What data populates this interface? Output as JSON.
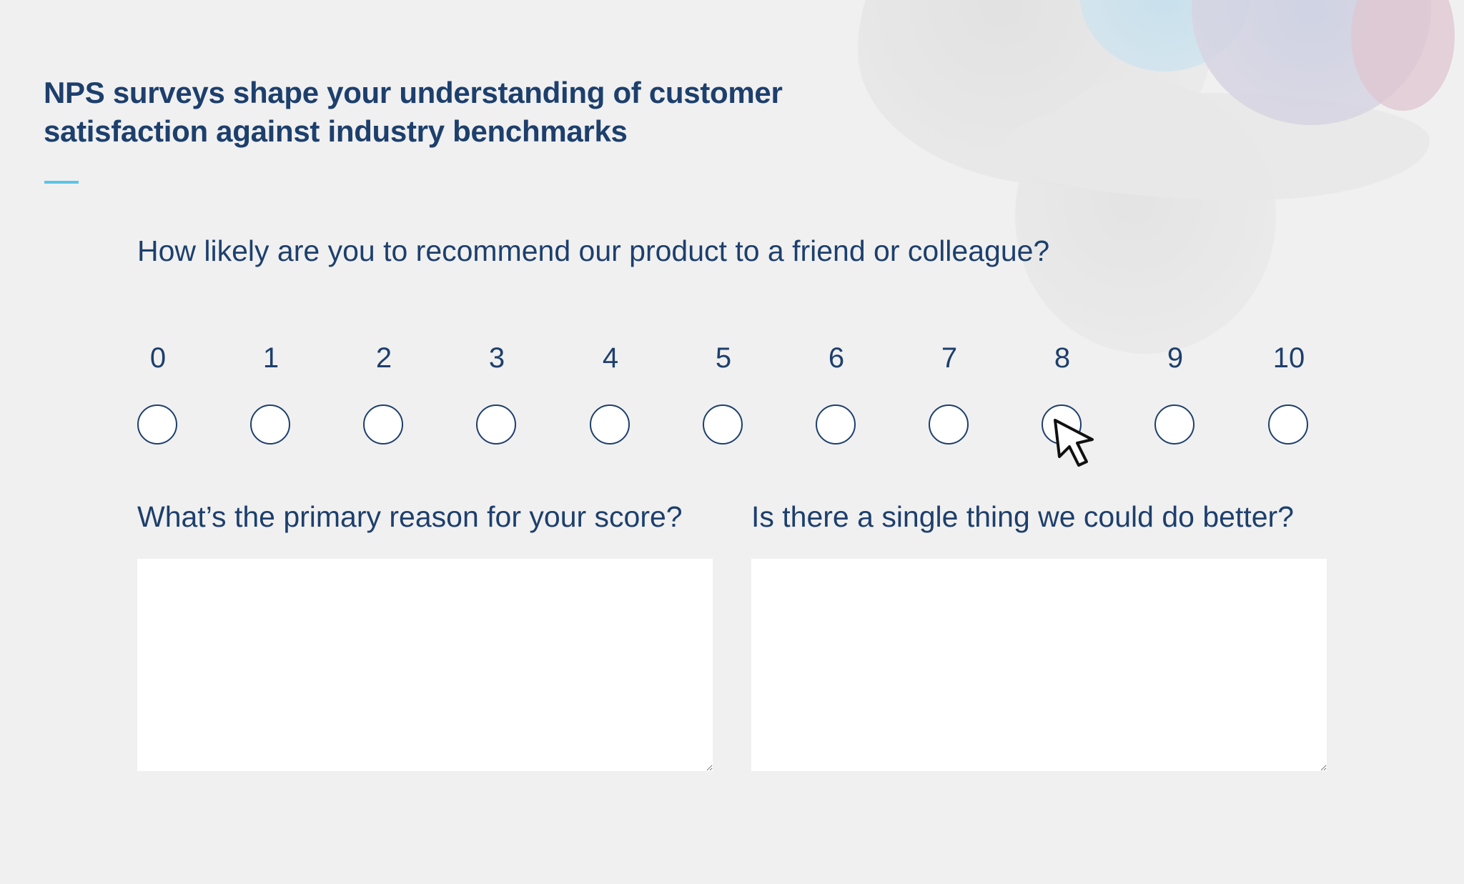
{
  "page": {
    "headline_line_1": "NPS surveys shape your understanding of customer",
    "headline_line_2": "satisfaction against industry benchmarks"
  },
  "survey": {
    "question_main": "How likely are you to recommend our product to a friend or colleague?",
    "scale_labels": [
      "0",
      "1",
      "2",
      "3",
      "4",
      "5",
      "6",
      "7",
      "8",
      "9",
      "10"
    ],
    "question_reason": "What’s the primary reason for your score?",
    "question_better": "Is there a single thing we could do better?"
  },
  "colors": {
    "heading": "#1d3f6c",
    "accent": "#5bc5e8",
    "background": "#f0f0f0",
    "input_bg": "#ffffff"
  },
  "icons": {
    "cursor": "arrow-cursor-icon"
  }
}
